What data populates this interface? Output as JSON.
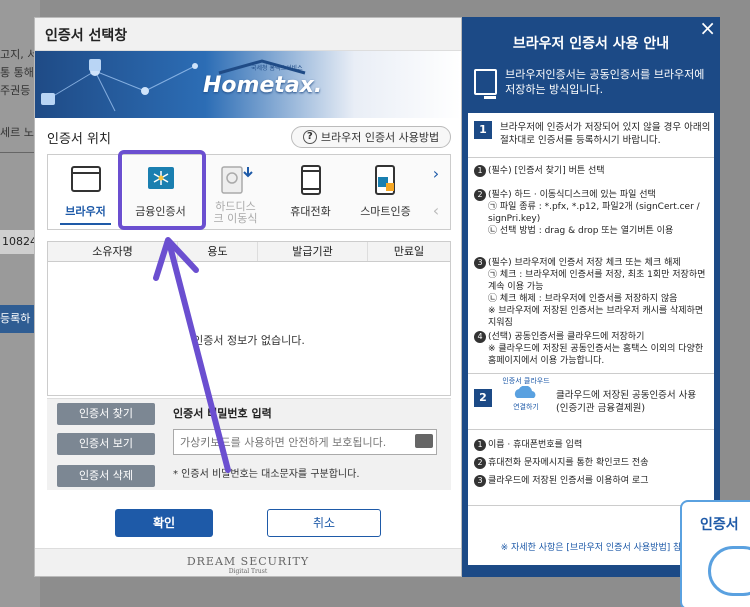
{
  "background_page": {
    "texts": [
      "고지, 서",
      "통 통해",
      "주권등",
      "세르 노"
    ],
    "row_value": "10824",
    "button_label": "등록하"
  },
  "dialog": {
    "title": "인증서 선택창",
    "logo_small": "국세청 홈택스서비스",
    "logo_word": "Hometax.",
    "location_header": "인증서 위치",
    "help_button": "브라우저 인증서 사용방법",
    "locations": [
      {
        "label": "브라우저",
        "icon": "browser-window-icon",
        "state": "active"
      },
      {
        "label": "금융인증서",
        "icon": "financial-certificate-icon",
        "state": "normal"
      },
      {
        "label": "하드디스크 이동식",
        "icon": "hard-disk-icon",
        "state": "disabled"
      },
      {
        "label": "휴대전화",
        "icon": "mobile-phone-icon",
        "state": "normal"
      },
      {
        "label": "스마트인증",
        "icon": "smart-auth-icon",
        "state": "normal"
      }
    ],
    "table_headers": [
      "소유자명",
      "용도",
      "발급기관",
      "만료일"
    ],
    "empty_message": "인증서 정보가 없습니다.",
    "cert_buttons": [
      "인증서 찾기",
      "인증서 보기",
      "인증서 삭제"
    ],
    "password_label": "인증서 비밀번호 입력",
    "password_placeholder": "가상키보드를 사용하면 안전하게 보호됩니다.",
    "password_note": "* 인증서 비밀번호는 대소문자를 구분합니다.",
    "ok_label": "확인",
    "cancel_label": "취소",
    "footer_brand": "DREAM SECURITY",
    "footer_tag": "Digital Trust"
  },
  "guide": {
    "title": "브라우저 인증서 사용 안내",
    "close": "×",
    "intro": "브라우저인증서는 공동인증서를 브라우저에 저장하는 방식입니다.",
    "step1_num": "1",
    "step1_title": "브라우저에 인증서가 저장되어 있지 않을 경우 아래의 절차대로 인증서를 등록하시기 바랍니다.",
    "items1": [
      {
        "n": "1",
        "text": "(필수) [인증서 찾기] 버튼 선택",
        "sub": []
      },
      {
        "n": "2",
        "text": "(필수) 하드 · 이동식디스크에 있는 파일 선택",
        "sub": [
          "㉠ 파일 종류 : *.pfx, *.p12, 파일2개 (signCert.cer / signPri.key)",
          "㉡ 선택 방법 : drag & drop 또는 열기버튼 이용"
        ]
      },
      {
        "n": "3",
        "text": "(필수) 브라우저에 인증서 저장 체크 또는 체크 해제",
        "sub": [
          "㉠ 체크 : 브라우저에 인증서를 저장, 최초 1회만 저장하면 계속 이용 가능",
          "㉡ 체크 해제 : 브라우저에 인증서를 저장하지 않음",
          "※ 브라우저에 저장된 인증서는 브라우저 캐시를 삭제하면 지워짐"
        ]
      },
      {
        "n": "4",
        "text": "(선택) 공동인증서를 클라우드에 저장하기",
        "sub": [
          "※ 클라우드에 저장된 공동인증서는 홈택스 이외의 다양한 홈페이지에서 이용 가능합니다."
        ]
      }
    ],
    "step2_num": "2",
    "cloud_label": "인증서 클라우드",
    "cloud_connect": "연결하기",
    "step2_title": "클라우드에 저장된 공동인증서 사용 (인증기관 금융결제원)",
    "items2": [
      {
        "n": "1",
        "text": "이름 · 휴대폰번호를 입력"
      },
      {
        "n": "2",
        "text": "휴대전화 문자메시지를 통한 확인코드 전송"
      },
      {
        "n": "3",
        "text": "클라우드에 저장된 인증서를 이용하여 로그"
      }
    ],
    "footer": "※ 자세한 사항은 [브라우저 인증서 사용방법] 참"
  },
  "popup": {
    "title": "인증서"
  },
  "colors": {
    "primary": "#1e5aa8",
    "guide_bg": "#1c4a86",
    "highlight": "#6b4fd0"
  }
}
